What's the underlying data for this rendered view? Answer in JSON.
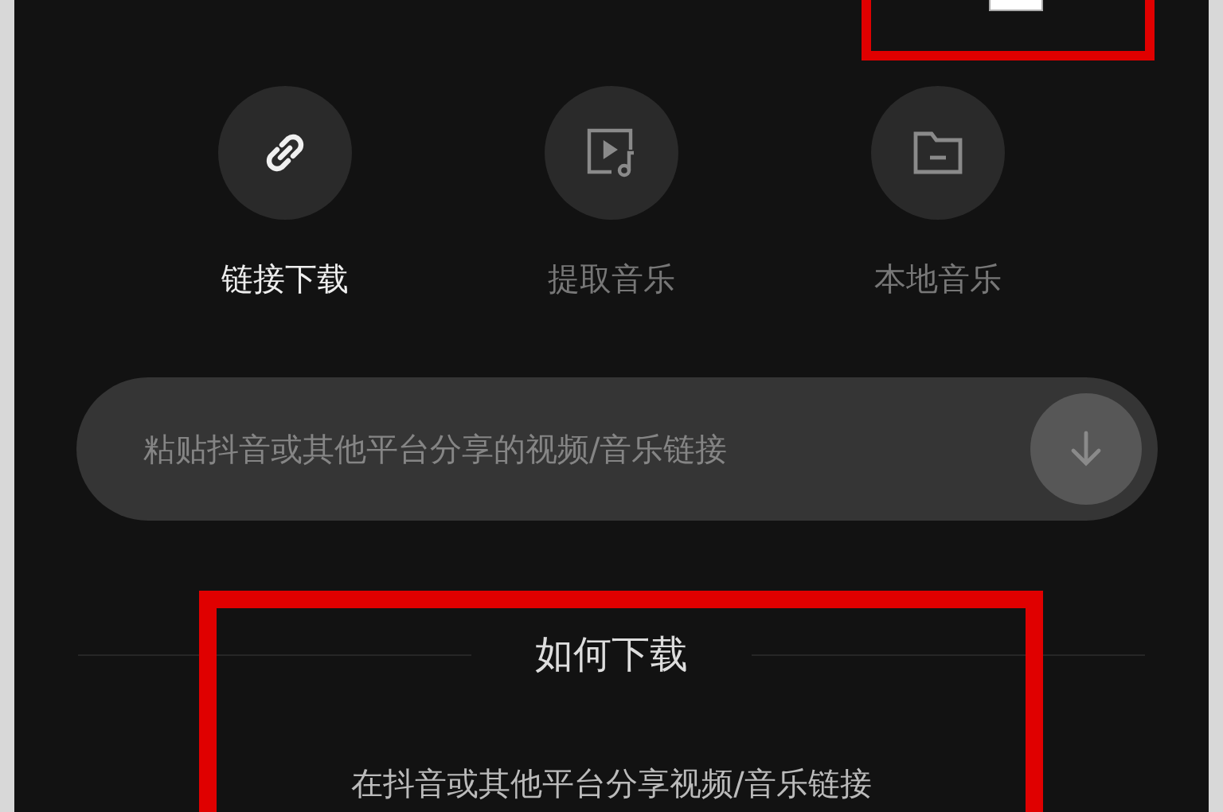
{
  "modes": [
    {
      "label": "链接下载",
      "kind": "link",
      "selected": true
    },
    {
      "label": "提取音乐",
      "kind": "video-music",
      "selected": false
    },
    {
      "label": "本地音乐",
      "kind": "folder",
      "selected": false
    }
  ],
  "link_field": {
    "placeholder": "粘贴抖音或其他平台分享的视频/音乐链接"
  },
  "help": {
    "title": "如何下载",
    "steps": [
      "在抖音或其他平台分享视频/音乐链接"
    ]
  }
}
